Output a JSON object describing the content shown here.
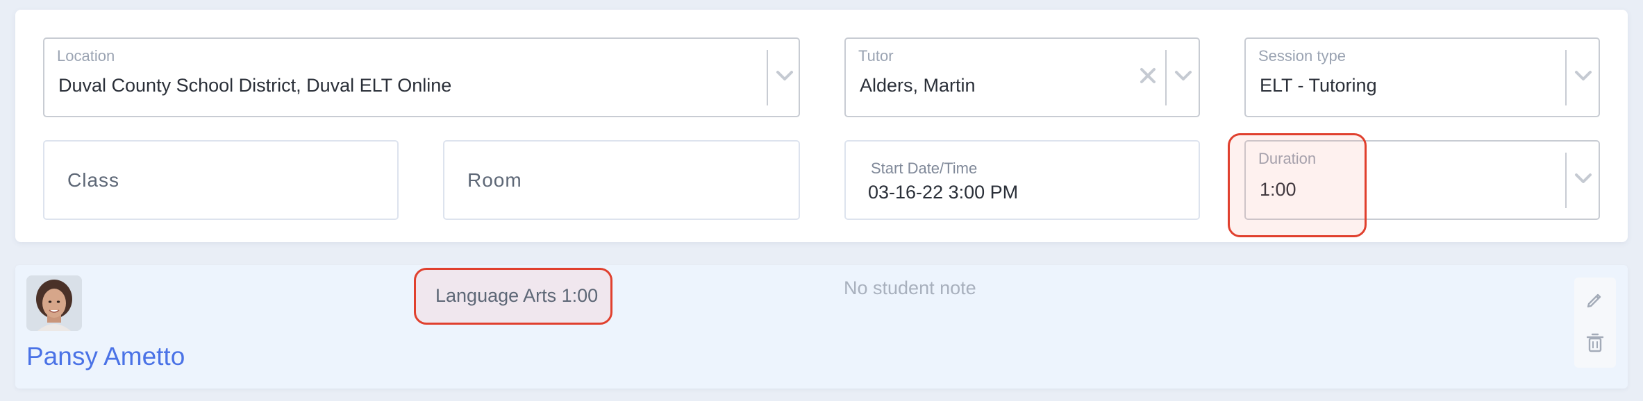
{
  "form": {
    "location": {
      "label": "Location",
      "value": "Duval County School District, Duval ELT Online"
    },
    "tutor": {
      "label": "Tutor",
      "value": "Alders, Martin"
    },
    "session_type": {
      "label": "Session type",
      "value": "ELT - Tutoring"
    },
    "class": {
      "placeholder": "Class"
    },
    "room": {
      "placeholder": "Room"
    },
    "start": {
      "label": "Start Date/Time",
      "value": "03-16-22 3:00 PM"
    },
    "duration": {
      "label": "Duration",
      "value": "1:00"
    }
  },
  "student": {
    "name": "Pansy Ametto",
    "tag": "Language Arts 1:00",
    "note_placeholder": "No student note"
  },
  "icons": [
    "chevron-down-icon",
    "clear-x-icon",
    "pencil-icon",
    "trash-icon"
  ],
  "colors": {
    "highlight": "#e0402e",
    "link": "#4a72e6",
    "row_bg": "#edf4fd"
  }
}
